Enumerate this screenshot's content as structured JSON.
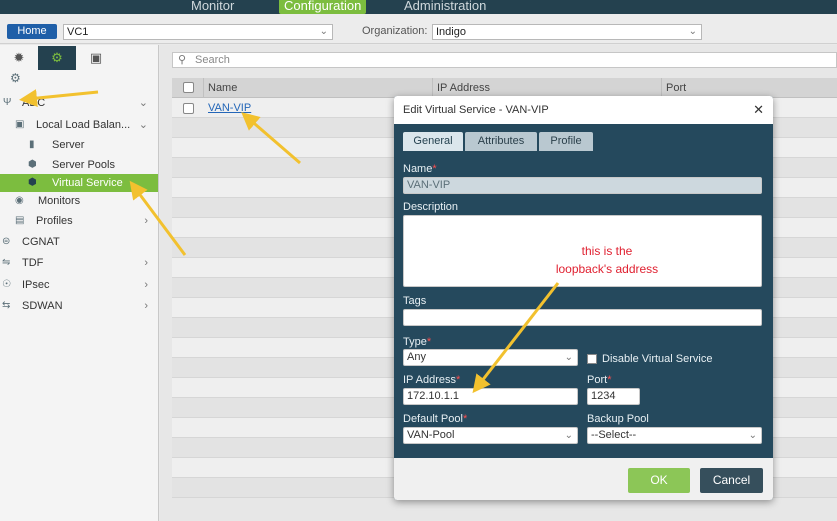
{
  "topnav": {
    "monitor": "Monitor",
    "configuration": "Configuration",
    "administration": "Administration"
  },
  "toolbar": {
    "home_label": "Home",
    "scope_value": "VC1",
    "org_label": "Organization:",
    "org_value": "Indigo"
  },
  "sidebar": {
    "tabs": [
      "network-icon",
      "gear-icon",
      "cube-icon"
    ],
    "items": [
      {
        "label": "ADC",
        "icon": "adc-icon"
      },
      {
        "label": "Local Load Balan...",
        "icon": "lb-icon"
      },
      {
        "label": "Server",
        "icon": "server-icon"
      },
      {
        "label": "Server Pools",
        "icon": "pool-icon"
      },
      {
        "label": "Virtual Service",
        "icon": "cube-icon"
      },
      {
        "label": "Monitors",
        "icon": "monitor-icon"
      },
      {
        "label": "Profiles",
        "icon": "profile-icon"
      },
      {
        "label": "CGNAT",
        "icon": "cgnat-icon"
      },
      {
        "label": "TDF",
        "icon": "tdf-icon"
      },
      {
        "label": "IPsec",
        "icon": "ipsec-icon"
      },
      {
        "label": "SDWAN",
        "icon": "sdwan-icon"
      }
    ]
  },
  "main": {
    "search_placeholder": "Search",
    "columns": [
      "Name",
      "IP Address",
      "Port"
    ],
    "rows": [
      {
        "name": "VAN-VIP"
      }
    ]
  },
  "modal": {
    "title": "Edit Virtual Service - VAN-VIP",
    "tabs": [
      "General",
      "Attributes",
      "Profile"
    ],
    "name_label": "Name",
    "name_value": "VAN-VIP",
    "description_label": "Description",
    "annotation_line1": "this is the",
    "annotation_line2": "loopback's address",
    "tags_label": "Tags",
    "type_label": "Type",
    "type_value": "Any",
    "disable_label": "Disable Virtual Service",
    "ip_label": "IP Address",
    "ip_value": "172.10.1.1",
    "port_label": "Port",
    "port_value": "1234",
    "default_pool_label": "Default Pool",
    "default_pool_value": "VAN-Pool",
    "backup_pool_label": "Backup Pool",
    "backup_pool_value": "--Select--",
    "ok_label": "OK",
    "cancel_label": "Cancel"
  },
  "colors": {
    "accent": "#7cbd3f",
    "nav_bg": "#24414f",
    "modal_bg": "#25495d",
    "annotation": "#e02030",
    "arrow": "#f2c12e"
  }
}
